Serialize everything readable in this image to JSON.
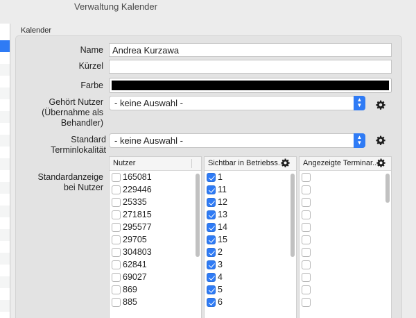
{
  "window": {
    "title": "Verwaltung Kalender"
  },
  "group": {
    "label": "Kalender"
  },
  "form": {
    "name_label": "Name",
    "name_value": "Andrea Kurzawa",
    "kuerzel_label": "Kürzel",
    "kuerzel_value": "",
    "farbe_label": "Farbe",
    "farbe_color": "#000000",
    "gehoert_label_1": "Gehört Nutzer",
    "gehoert_label_2": "(Übernahme als",
    "gehoert_label_3": "Behandler)",
    "gehoert_value": "- keine Auswahl -",
    "standard_label_1": "Standard",
    "standard_label_2": "Terminlokalität",
    "standard_value": "- keine Auswahl -",
    "anzeige_label_1": "Standardanzeige",
    "anzeige_label_2": "bei Nutzer"
  },
  "tables": {
    "nutzer": {
      "header": "Nutzer",
      "rows": [
        {
          "label": "165081",
          "checked": false
        },
        {
          "label": "229446",
          "checked": false
        },
        {
          "label": "25335",
          "checked": false
        },
        {
          "label": "271815",
          "checked": false
        },
        {
          "label": "295577",
          "checked": false
        },
        {
          "label": "29705",
          "checked": false
        },
        {
          "label": "304803",
          "checked": false
        },
        {
          "label": "62841",
          "checked": false
        },
        {
          "label": "69027",
          "checked": false
        },
        {
          "label": "869",
          "checked": false
        },
        {
          "label": "885",
          "checked": false
        }
      ]
    },
    "sichtbar": {
      "header": "Sichtbar in Betriebss...",
      "rows": [
        {
          "label": "1",
          "checked": true
        },
        {
          "label": "11",
          "checked": true
        },
        {
          "label": "12",
          "checked": true
        },
        {
          "label": "13",
          "checked": true
        },
        {
          "label": "14",
          "checked": true
        },
        {
          "label": "15",
          "checked": true
        },
        {
          "label": "2",
          "checked": true
        },
        {
          "label": "3",
          "checked": true
        },
        {
          "label": "4",
          "checked": true
        },
        {
          "label": "5",
          "checked": true
        },
        {
          "label": "6",
          "checked": true
        }
      ]
    },
    "angezeigte": {
      "header": "Angezeigte Terminar...",
      "rows": [
        {
          "label": "",
          "checked": false
        },
        {
          "label": "",
          "checked": false
        },
        {
          "label": "",
          "checked": false
        },
        {
          "label": "",
          "checked": false
        },
        {
          "label": "",
          "checked": false
        },
        {
          "label": "",
          "checked": false
        },
        {
          "label": "",
          "checked": false
        },
        {
          "label": "",
          "checked": false
        },
        {
          "label": "",
          "checked": false
        },
        {
          "label": "",
          "checked": false
        },
        {
          "label": "",
          "checked": false
        }
      ]
    }
  },
  "icons": {
    "gear": "gear-icon",
    "stepper": "chevron-up-down-icon",
    "checkmark": "checkmark-icon"
  },
  "colors": {
    "accent": "#2f7bf5"
  }
}
